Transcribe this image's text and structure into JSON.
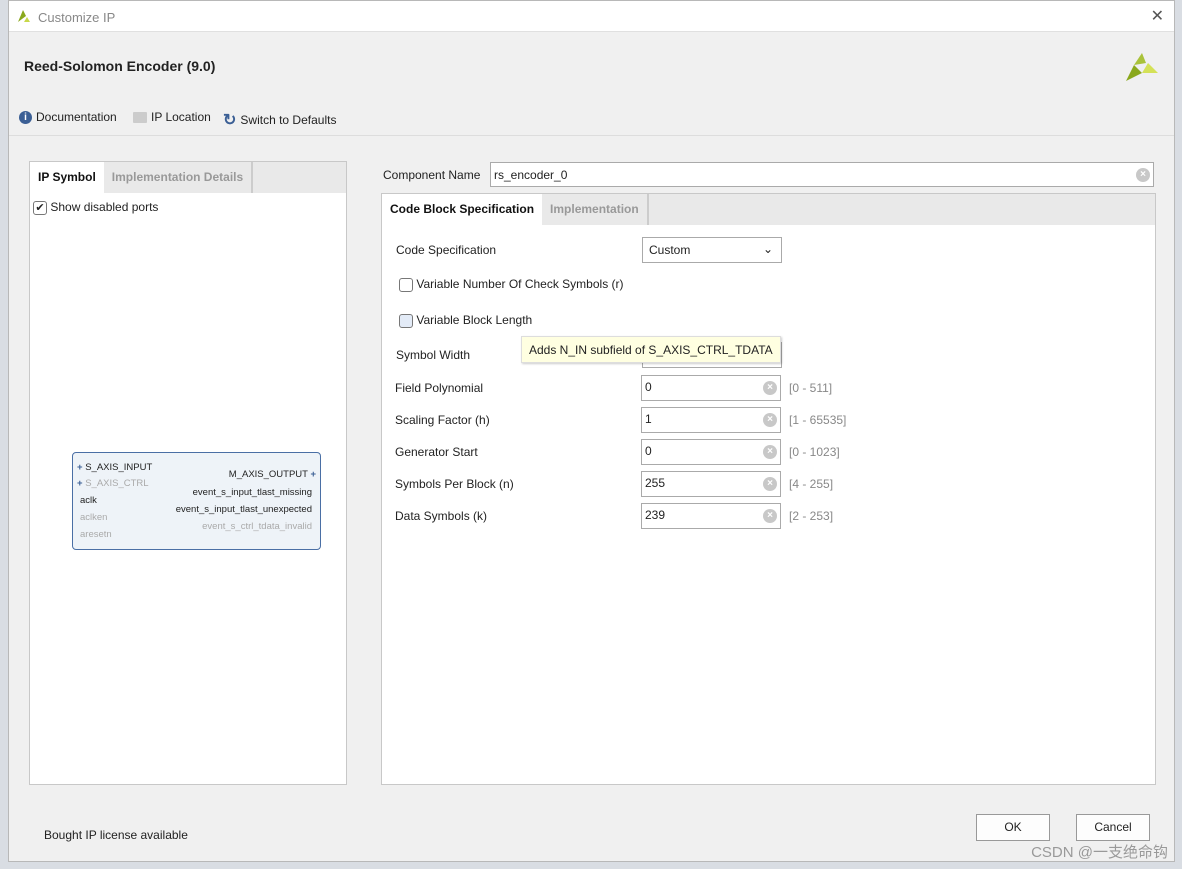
{
  "window": {
    "title": "Customize IP",
    "close": "✕"
  },
  "header": {
    "title": "Reed-Solomon Encoder (9.0)"
  },
  "toolbar": {
    "documentation": "Documentation",
    "ip_location": "IP Location",
    "switch_defaults": "Switch to Defaults"
  },
  "left": {
    "tabs": [
      "IP Symbol",
      "Implementation Details"
    ],
    "show_disabled": "Show disabled ports",
    "show_disabled_checked": true,
    "symbol": {
      "inputs": [
        "S_AXIS_INPUT",
        "S_AXIS_CTRL",
        "aclk",
        "aclken",
        "aresetn"
      ],
      "outputs": [
        "M_AXIS_OUTPUT",
        "event_s_input_tlast_missing",
        "event_s_input_tlast_unexpected",
        "event_s_ctrl_tdata_invalid"
      ]
    }
  },
  "right": {
    "component_label": "Component Name",
    "component_value": "rs_encoder_0",
    "tabs": [
      "Code Block Specification",
      "Implementation"
    ],
    "code_spec_label": "Code Specification",
    "code_spec_value": "Custom",
    "var_check": "Variable Number Of Check Symbols (r)",
    "var_block": "Variable Block Length",
    "tooltip": "Adds N_IN subfield of S_AXIS_CTRL_TDATA",
    "symbol_width": "Symbol Width",
    "fields": [
      {
        "label": "Field Polynomial",
        "value": "0",
        "range": "[0 - 511]"
      },
      {
        "label": "Scaling Factor (h)",
        "value": "1",
        "range": "[1 - 65535]"
      },
      {
        "label": "Generator Start",
        "value": "0",
        "range": "[0 - 1023]"
      },
      {
        "label": "Symbols Per Block (n)",
        "value": "255",
        "range": "[4 - 255]"
      },
      {
        "label": "Data Symbols (k)",
        "value": "239",
        "range": "[2 - 253]"
      }
    ]
  },
  "footer": {
    "license": "Bought IP license available",
    "ok": "OK",
    "cancel": "Cancel"
  },
  "watermark": "CSDN @一支绝命钩"
}
